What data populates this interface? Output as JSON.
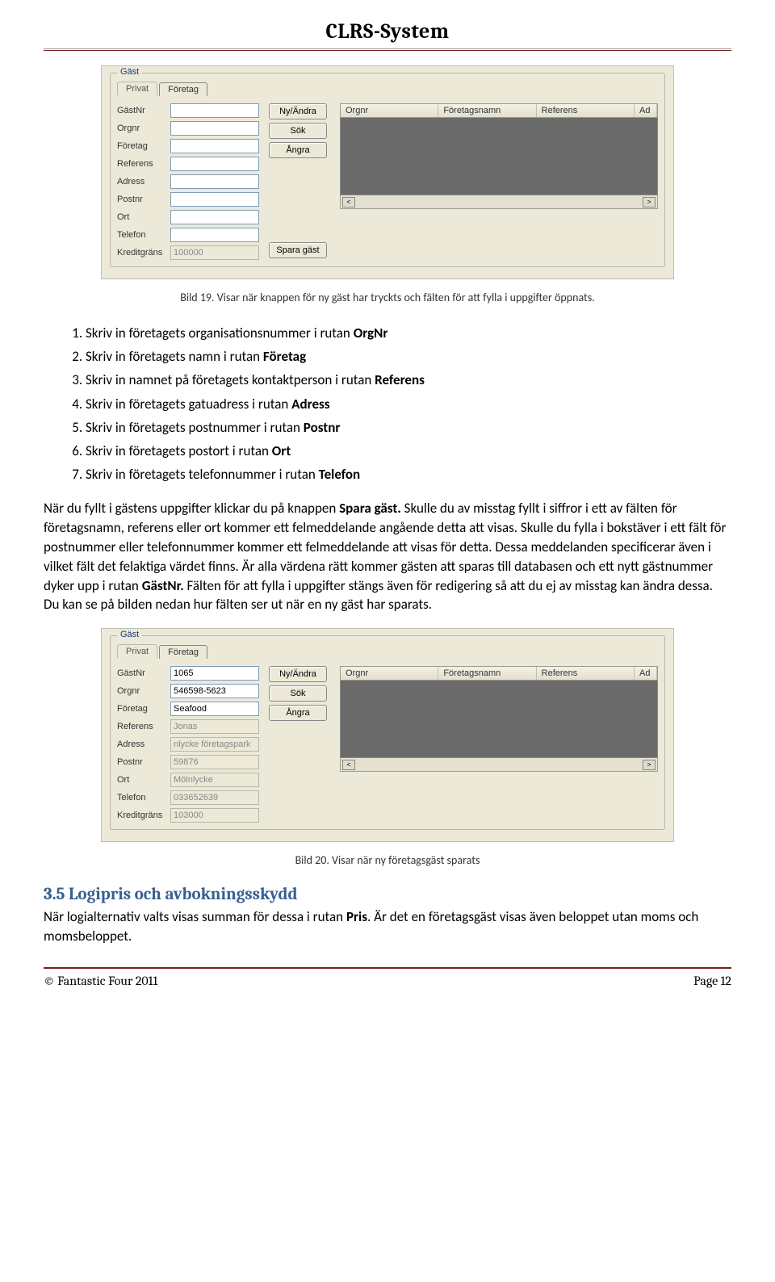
{
  "header": {
    "title": "CLRS-System"
  },
  "figure1": {
    "group_legend": "Gäst",
    "tabs": {
      "privat": "Privat",
      "foretag": "Företag"
    },
    "labels": {
      "gastnr": "GästNr",
      "orgnr": "Orgnr",
      "foretag": "Företag",
      "referens": "Referens",
      "adress": "Adress",
      "postnr": "Postnr",
      "ort": "Ort",
      "telefon": "Telefon",
      "kreditgrans": "Kreditgräns"
    },
    "values": {
      "gastnr": "",
      "orgnr": "",
      "foretag": "",
      "referens": "",
      "adress": "",
      "postnr": "",
      "ort": "",
      "telefon": "",
      "kreditgrans": "100000"
    },
    "buttons": {
      "nyandra": "Ny/Ändra",
      "sok": "Sök",
      "angra": "Ångra",
      "spara": "Spara gäst"
    },
    "grid_headers": {
      "orgnr": "Orgnr",
      "foretagsnamn": "Företagsnamn",
      "referens": "Referens",
      "ad": "Ad"
    }
  },
  "caption1": "Bild 19. Visar när knappen för ny gäst har tryckts och fälten för att fylla i uppgifter öppnats.",
  "steps": [
    {
      "pre": "Skriv in företagets organisationsnummer i rutan ",
      "bold": "OrgNr"
    },
    {
      "pre": "Skriv in företagets namn i rutan ",
      "bold": "Företag"
    },
    {
      "pre": "Skriv in namnet på företagets kontaktperson i rutan ",
      "bold": "Referens"
    },
    {
      "pre": "Skriv in företagets gatuadress i rutan ",
      "bold": "Adress"
    },
    {
      "pre": "Skriv in företagets postnummer i rutan ",
      "bold": "Postnr"
    },
    {
      "pre": "Skriv in företagets postort i rutan ",
      "bold": "Ort"
    },
    {
      "pre": "Skriv in företagets telefonnummer i rutan ",
      "bold": "Telefon"
    }
  ],
  "paragraph": {
    "p1a": "När du fyllt i gästens uppgifter klickar du på knappen ",
    "p1b": "Spara gäst.",
    "p1c": " Skulle du av misstag fyllt i siffror i ett av fälten för företagsnamn, referens eller ort kommer ett felmeddelande angående detta att visas. Skulle du fylla i bokstäver i ett fält för postnummer eller telefonnummer kommer ett felmeddelande att visas för detta. Dessa meddelanden specificerar även i vilket fält det felaktiga värdet finns. Är alla värdena rätt kommer gästen att sparas till databasen och ett nytt gästnummer dyker upp i rutan ",
    "p1d": "GästNr.",
    "p1e": " Fälten för att fylla i uppgifter stängs även för redigering så att du ej av misstag kan ändra dessa. Du kan se på bilden nedan hur fälten ser ut när en ny gäst har sparats."
  },
  "figure2": {
    "group_legend": "Gäst",
    "tabs": {
      "privat": "Privat",
      "foretag": "Företag"
    },
    "labels": {
      "gastnr": "GästNr",
      "orgnr": "Orgnr",
      "foretag": "Företag",
      "referens": "Referens",
      "adress": "Adress",
      "postnr": "Postnr",
      "ort": "Ort",
      "telefon": "Telefon",
      "kreditgrans": "Kreditgräns"
    },
    "values": {
      "gastnr": "1065",
      "orgnr": "546598-5623",
      "foretag": "Seafood",
      "referens": "Jonas",
      "adress": "nlycke företagspark",
      "postnr": "59876",
      "ort": "Mölnlycke",
      "telefon": "033652639",
      "kreditgrans": "103000"
    },
    "buttons": {
      "nyandra": "Ny/Ändra",
      "sok": "Sök",
      "angra": "Ångra"
    },
    "grid_headers": {
      "orgnr": "Orgnr",
      "foretagsnamn": "Företagsnamn",
      "referens": "Referens",
      "ad": "Ad"
    }
  },
  "caption2": "Bild 20. Visar när ny företagsgäst sparats",
  "section": {
    "heading": "3.5 Logipris och avbokningsskydd",
    "body_a": "När logialternativ valts visas summan för dessa i rutan ",
    "body_bold": "Pris",
    "body_b": ". Är det en företagsgäst visas även beloppet utan moms och momsbeloppet."
  },
  "footer": {
    "left": "© Fantastic Four 2011",
    "right": "Page 12"
  }
}
